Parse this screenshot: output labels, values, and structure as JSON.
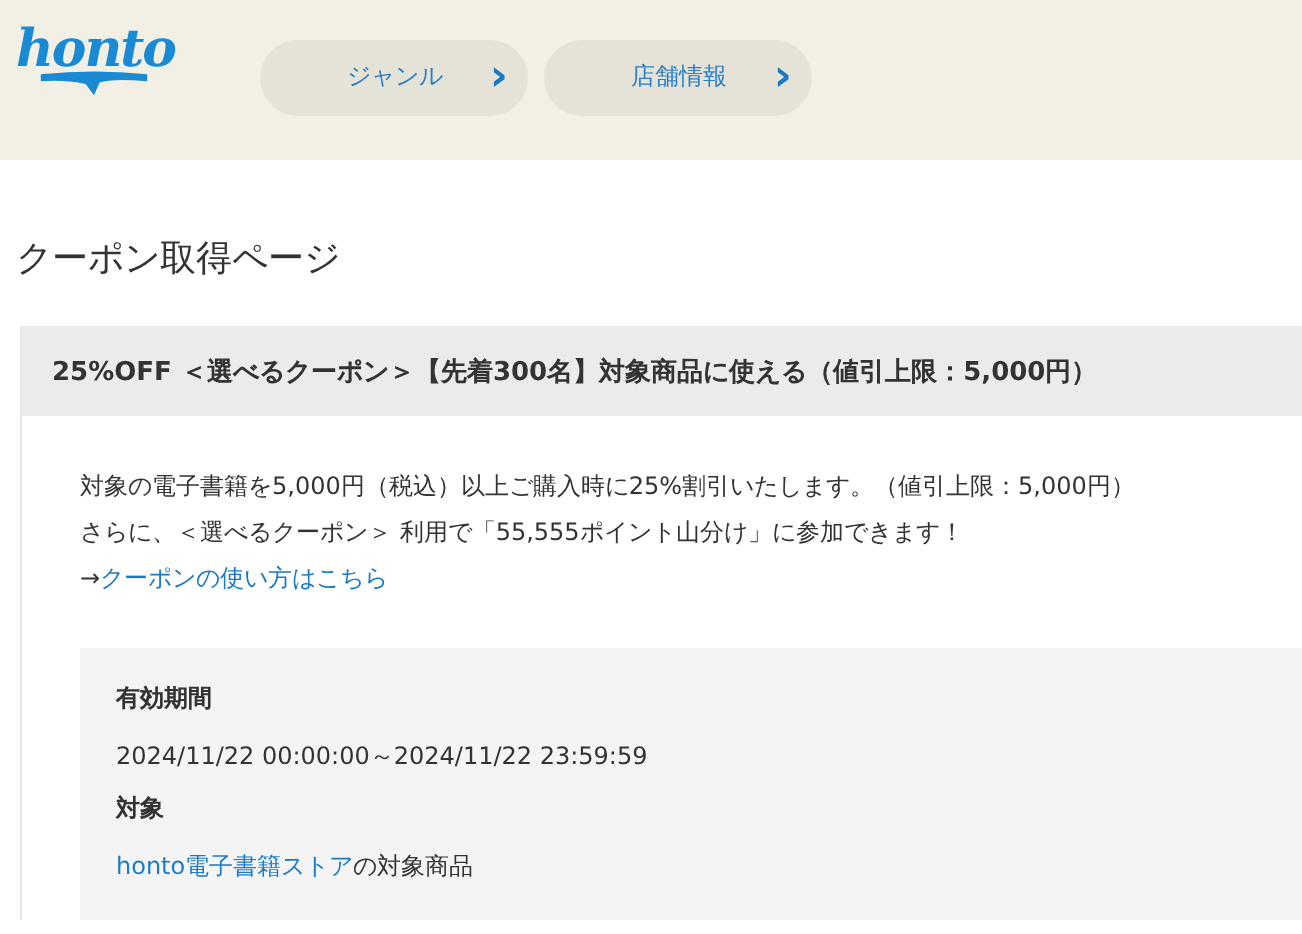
{
  "header": {
    "logo": "honto",
    "nav": [
      {
        "label": "ジャンル",
        "icon": "›"
      },
      {
        "label": "店舗情報",
        "icon": "›"
      }
    ]
  },
  "page_title": "クーポン取得ページ",
  "coupon": {
    "title": "25%OFF ＜選べるクーポン＞【先着300名】対象商品に使える（値引上限：5,000円）",
    "description": [
      "対象の電子書籍を5,000円（税込）以上ご購入時に25%割引いたします。（値引上限：5,000円）",
      "さらに、＜選べるクーポン＞ 利用で「55,555ポイント山分け」に参加できます！"
    ],
    "howto": {
      "arrow": "→",
      "link": "クーポンの使い方はこちら"
    },
    "details": [
      {
        "label": "有効期間",
        "value": "2024/11/22 00:00:00～2024/11/22 23:59:59"
      },
      {
        "label": "対象",
        "link": "honto電子書籍ストア",
        "value": "の対象商品"
      }
    ]
  }
}
